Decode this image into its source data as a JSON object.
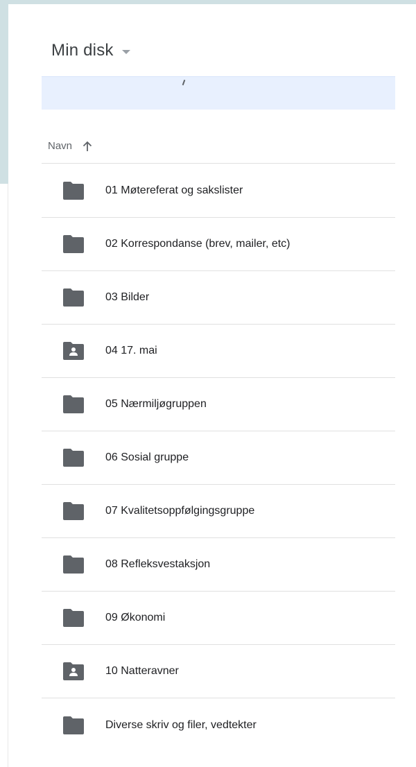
{
  "header": {
    "title": "Min disk",
    "dropdown_icon": "caret-down-icon"
  },
  "list": {
    "column_name_label": "Navn",
    "sort_icon": "arrow-up-icon",
    "items": [
      {
        "name": "01 Møtereferat og sakslister",
        "icon": "folder-icon"
      },
      {
        "name": "02 Korrespondanse (brev, mailer, etc)",
        "icon": "folder-icon"
      },
      {
        "name": "03 Bilder",
        "icon": "folder-icon"
      },
      {
        "name": "04 17. mai",
        "icon": "shared-folder-icon"
      },
      {
        "name": "05 Nærmiljøgruppen",
        "icon": "folder-icon"
      },
      {
        "name": "06 Sosial gruppe",
        "icon": "folder-icon"
      },
      {
        "name": "07 Kvalitetsoppfølgingsgruppe",
        "icon": "folder-icon"
      },
      {
        "name": "08 Refleksvestaksjon",
        "icon": "folder-icon"
      },
      {
        "name": "09 Økonomi",
        "icon": "folder-icon"
      },
      {
        "name": "10 Natteravner",
        "icon": "shared-folder-icon"
      },
      {
        "name": "Diverse skriv og filer, vedtekter",
        "icon": "folder-icon"
      }
    ]
  },
  "colors": {
    "banner": "#e8f0fe",
    "folder": "#5f6368",
    "text": "#202124"
  }
}
